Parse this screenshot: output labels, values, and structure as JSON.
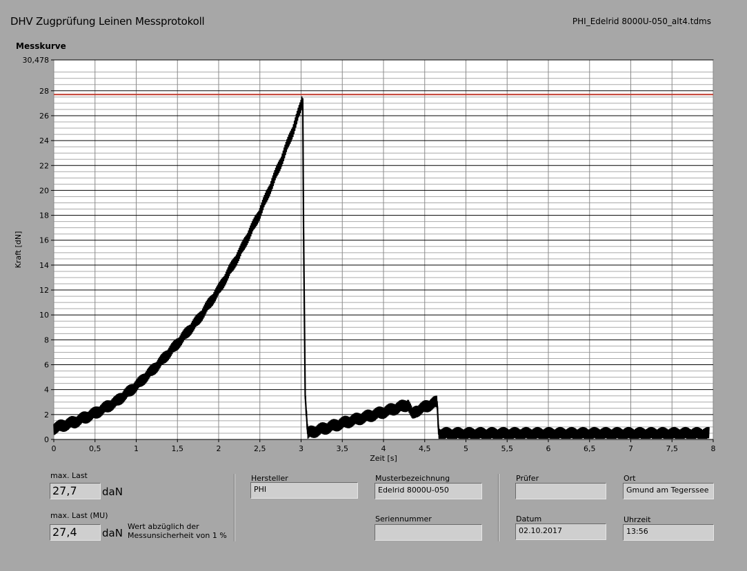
{
  "header": {
    "title": "DHV Zugprüfung Leinen Messprotokoll",
    "filename": "PHI_Edelrid 8000U-050_alt4.tdms"
  },
  "chart_data": {
    "type": "line",
    "title": "Messkurve",
    "xlabel": "Zeit [s]",
    "ylabel": "Kraft [dN]",
    "xlim": [
      0,
      8
    ],
    "ylim": [
      0,
      30.478
    ],
    "y_top_tick_label": "30,478",
    "x_ticks": [
      "0",
      "0,5",
      "1",
      "1,5",
      "2",
      "2,5",
      "3",
      "3,5",
      "4",
      "4,5",
      "5",
      "5,5",
      "6",
      "6,5",
      "7",
      "7,5",
      "8"
    ],
    "y_ticks": [
      "0",
      "2",
      "4",
      "6",
      "8",
      "10",
      "12",
      "14",
      "16",
      "18",
      "20",
      "22",
      "24",
      "26",
      "28"
    ],
    "grid": true,
    "reference_line": {
      "y": 27.7,
      "color": "#c0392b"
    },
    "series": [
      {
        "color": "#000000",
        "x": [
          0,
          0.25,
          0.5,
          0.75,
          1.0,
          1.25,
          1.5,
          1.75,
          2.0,
          2.25,
          2.5,
          2.75,
          2.9,
          3.0,
          3.02,
          3.03,
          3.05,
          3.08,
          3.5,
          4.0,
          4.25,
          4.3,
          4.35,
          4.4,
          4.5,
          4.6,
          4.65,
          4.67,
          5.0,
          6.0,
          7.0,
          7.95
        ],
        "y": [
          0.9,
          1.4,
          2.1,
          3.0,
          4.3,
          5.9,
          7.7,
          9.6,
          12.0,
          14.9,
          18.2,
          22.2,
          24.8,
          26.8,
          27.4,
          17.0,
          3.5,
          0.5,
          1.3,
          2.2,
          2.7,
          2.8,
          2.0,
          2.3,
          2.6,
          2.9,
          3.0,
          0.45,
          0.45,
          0.45,
          0.45,
          0.45
        ],
        "band": 0.55
      }
    ]
  },
  "footer": {
    "max_last_label": "max. Last",
    "max_last_value": "27,7",
    "max_last_unit": "daN",
    "max_last_mu_label": "max. Last (MU)",
    "max_last_mu_value": "27,4",
    "max_last_mu_unit": "daN",
    "mu_note_line1": "Wert abzüglich der",
    "mu_note_line2": "Messunsicherheit von 1 %",
    "hersteller_label": "Hersteller",
    "hersteller_value": "PHI",
    "muster_label": "Musterbezeichnung",
    "muster_value": "Edelrid 8000U-050",
    "serien_label": "Seriennummer",
    "serien_value": "",
    "pruefer_label": "Prüfer",
    "pruefer_value": "",
    "ort_label": "Ort",
    "ort_value": "Gmund am Tegerssee",
    "datum_label": "Datum",
    "datum_value": "02.10.2017",
    "uhrzeit_label": "Uhrzeit",
    "uhrzeit_value": "13:56"
  }
}
